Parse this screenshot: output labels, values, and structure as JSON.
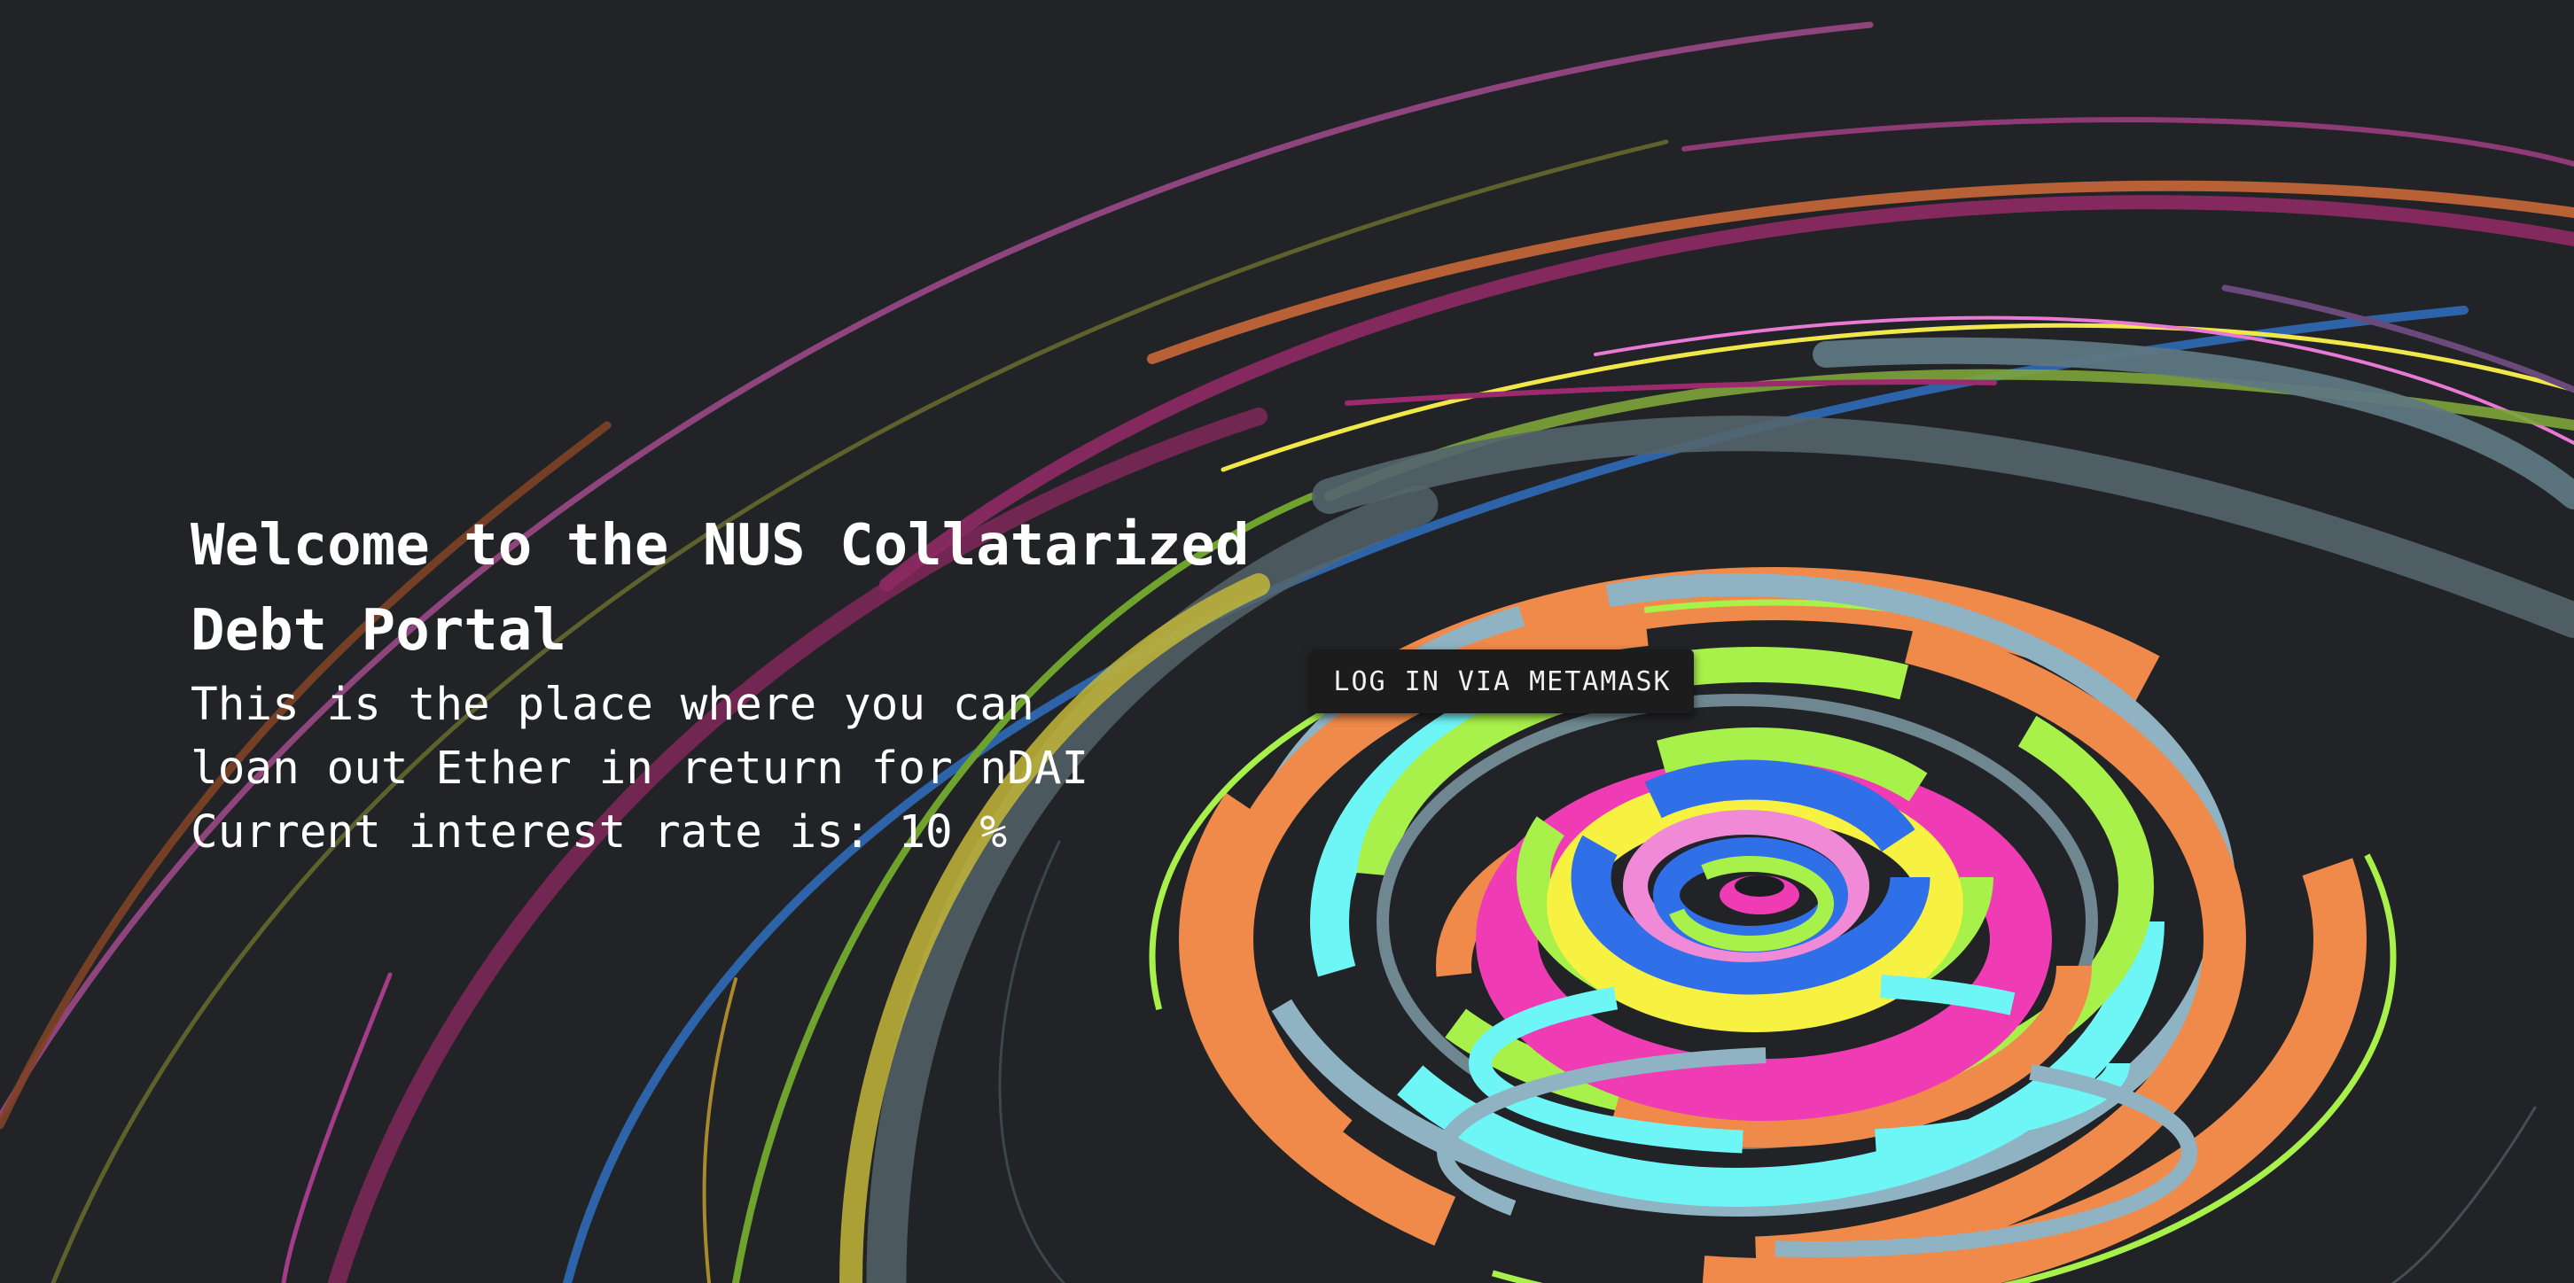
{
  "hero": {
    "title": "Welcome to the NUS Collatarized Debt Portal",
    "description_line1": "This is the place where you can",
    "description_line2": "loan out Ether in return for nDAI",
    "rate_prefix": "Current interest rate is: ",
    "interest_rate": "10",
    "rate_unit": " %"
  },
  "login_button": {
    "label": "LOG IN VIA METAMASK"
  },
  "colors": {
    "background": "#212326",
    "text": "#ffffff",
    "button_background": "#1c1c1d",
    "ring_palette": [
      "#f08a4b",
      "#6ef6f6",
      "#a8f04a",
      "#f03cb4",
      "#2f6fe8",
      "#f7f241",
      "#8fb3c2",
      "#a83a7e",
      "#6e8790",
      "#f08ad6",
      "#e8643a"
    ]
  }
}
